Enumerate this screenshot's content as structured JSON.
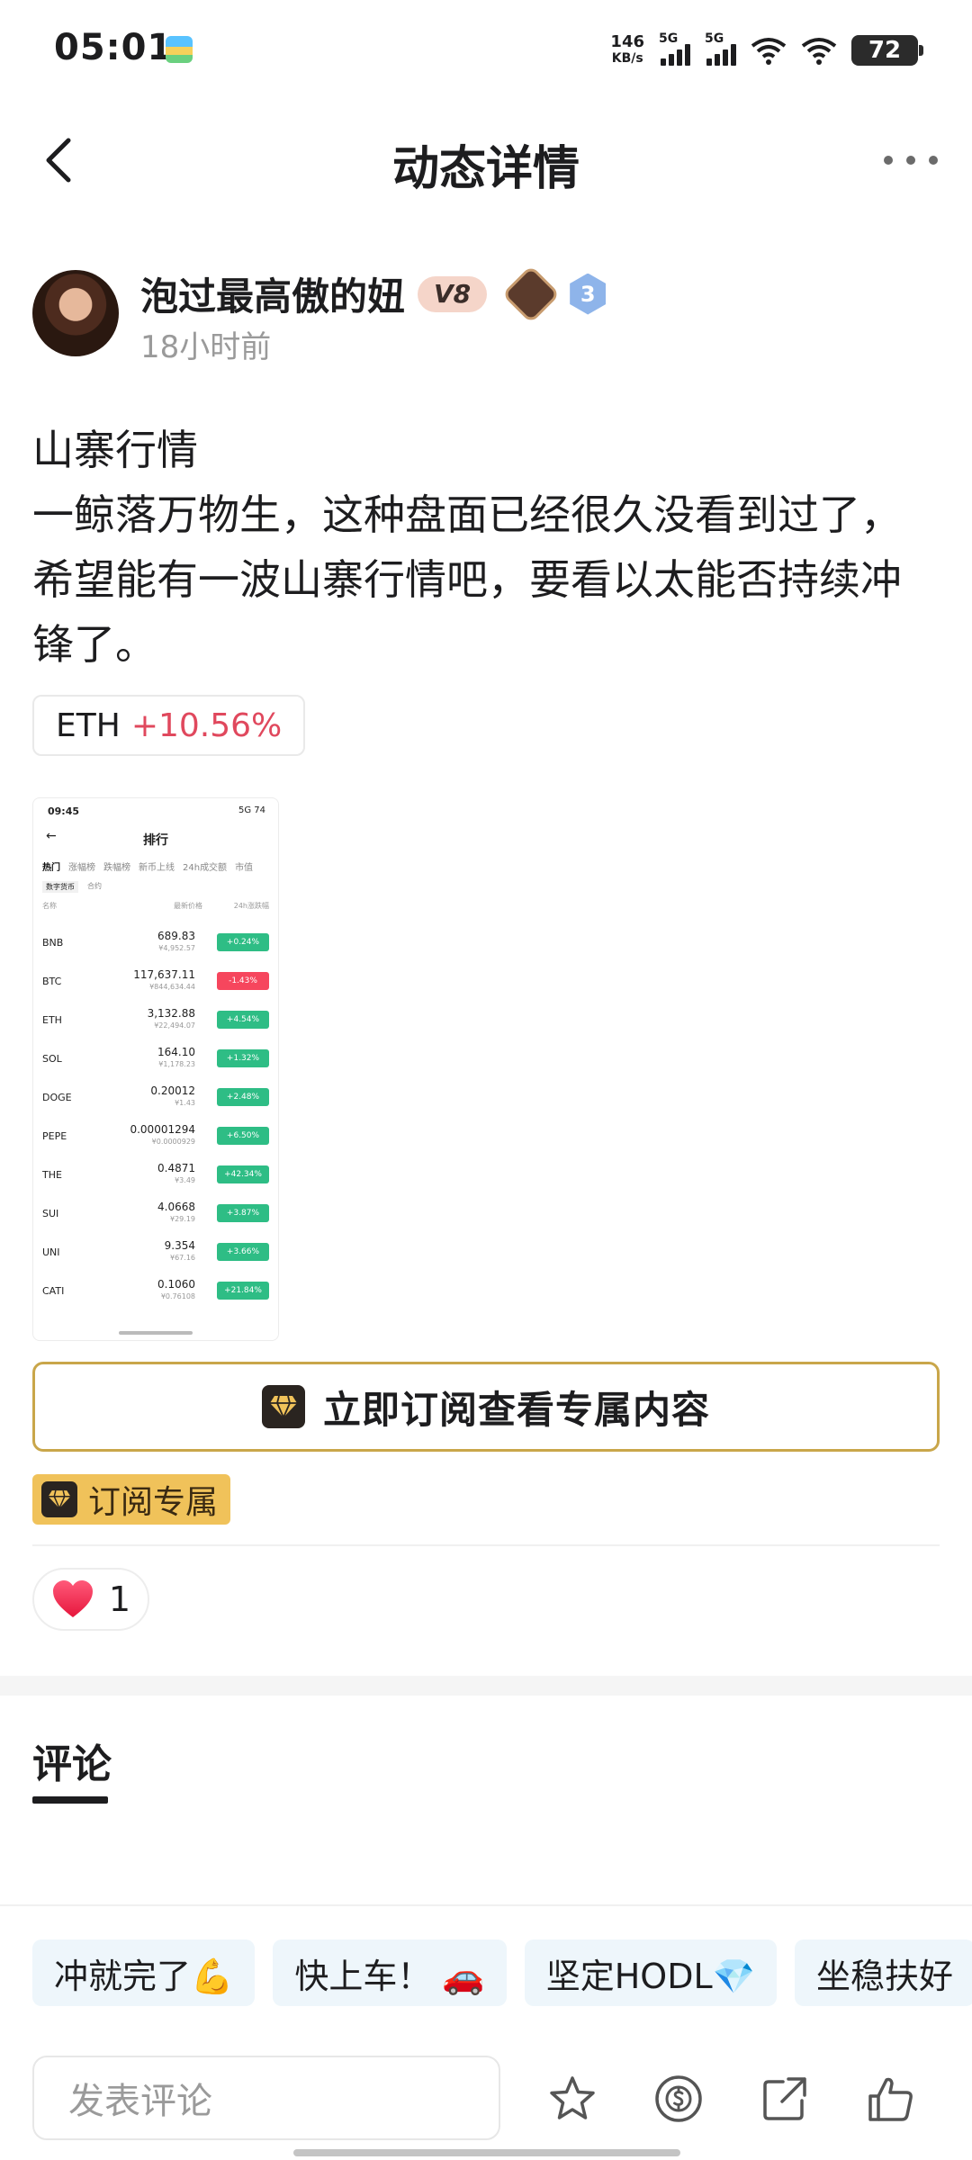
{
  "status_bar": {
    "time": "05:01",
    "net_speed_value": "146",
    "net_speed_unit": "KB/s",
    "sim1": "5G",
    "sim2": "5G",
    "battery": "72"
  },
  "header": {
    "title": "动态详情",
    "back_icon": "chevron-left-icon",
    "more_icon": "more-horizontal-icon"
  },
  "author": {
    "name": "泡过最高傲的妞",
    "vip": "V8",
    "level_badge": "3",
    "time": "18小时前"
  },
  "post": {
    "lines": [
      "山寨行情",
      "一鲸落万物生，这种盘面已经很久没看到过了，希望能有一波山寨行情吧，要看以太能否持续冲锋了。"
    ],
    "ticker": {
      "symbol": "ETH",
      "change": "+10.56%",
      "change_color": "#e0485d"
    }
  },
  "screenshot": {
    "time": "09:45",
    "status_right": "5G 74",
    "title": "排行",
    "tabs": [
      "热门",
      "涨幅榜",
      "跌幅榜",
      "新币上线",
      "24h成交额",
      "市值"
    ],
    "subtabs": [
      "数字货币",
      "合约"
    ],
    "columns": [
      "名称",
      "最新价格",
      "24h涨跌幅"
    ],
    "rows": [
      {
        "symbol": "BNB",
        "price": "689.83",
        "cny": "¥4,952.57",
        "change": "+0.24%",
        "up": true
      },
      {
        "symbol": "BTC",
        "price": "117,637.11",
        "cny": "¥844,634.44",
        "change": "-1.43%",
        "up": false
      },
      {
        "symbol": "ETH",
        "price": "3,132.88",
        "cny": "¥22,494.07",
        "change": "+4.54%",
        "up": true
      },
      {
        "symbol": "SOL",
        "price": "164.10",
        "cny": "¥1,178.23",
        "change": "+1.32%",
        "up": true
      },
      {
        "symbol": "DOGE",
        "price": "0.20012",
        "cny": "¥1.43",
        "change": "+2.48%",
        "up": true
      },
      {
        "symbol": "PEPE",
        "price": "0.00001294",
        "cny": "¥0.0000929",
        "change": "+6.50%",
        "up": true
      },
      {
        "symbol": "THE",
        "price": "0.4871",
        "cny": "¥3.49",
        "change": "+42.34%",
        "up": true
      },
      {
        "symbol": "SUI",
        "price": "4.0668",
        "cny": "¥29.19",
        "change": "+3.87%",
        "up": true
      },
      {
        "symbol": "UNI",
        "price": "9.354",
        "cny": "¥67.16",
        "change": "+3.66%",
        "up": true
      },
      {
        "symbol": "CATI",
        "price": "0.1060",
        "cny": "¥0.76108",
        "change": "+21.84%",
        "up": true
      }
    ],
    "up_color": "#2ebd85",
    "down_color": "#f6465d"
  },
  "subscribe": {
    "button_label": "立即订阅查看专属内容",
    "tag_label": "订阅专属",
    "accent": "#c9a64a"
  },
  "likes": {
    "count": "1",
    "icon": "heart-icon"
  },
  "comments": {
    "title": "评论",
    "quick_replies": [
      "冲就完了💪",
      "快上车！ 🚗",
      "坚定HODL💎",
      "坐稳扶好"
    ],
    "input_placeholder": "发表评论"
  },
  "bottom_actions": [
    "star-icon",
    "coin-icon",
    "share-icon",
    "thumbs-up-icon"
  ]
}
